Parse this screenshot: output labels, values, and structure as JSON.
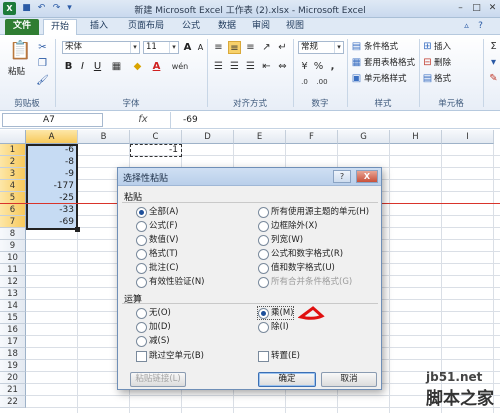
{
  "window": {
    "title": "新建 Microsoft Excel 工作表 (2).xlsx - Microsoft Excel",
    "app_icon": "X",
    "qat_icons": [
      "save-icon",
      "undo-icon",
      "redo-icon"
    ],
    "window_controls": [
      "minimize",
      "maximize",
      "close"
    ]
  },
  "tabs": [
    "文件",
    "开始",
    "插入",
    "页面布局",
    "公式",
    "数据",
    "审阅",
    "视图"
  ],
  "ribbon": {
    "clipboard": {
      "label": "剪贴板",
      "paste": "粘贴"
    },
    "font": {
      "label": "字体",
      "font_name": "宋体",
      "font_size": "11",
      "bold": "B",
      "italic": "I",
      "underline": "U",
      "grow": "A",
      "shrink": "A",
      "font_color": "A",
      "wen": "wén"
    },
    "alignment": {
      "label": "对齐方式"
    },
    "number": {
      "label": "数字",
      "format": "常规",
      "percent": "%",
      "comma": ",",
      "currency": "¥",
      "dec_inc": ".0",
      "dec_dec": ".00"
    },
    "styles": {
      "label": "样式",
      "cond": "条件格式",
      "table": "套用表格格式",
      "cell": "单元格样式"
    },
    "cells": {
      "label": "单元格",
      "insert": "插入",
      "delete": "删除",
      "format": "格式"
    }
  },
  "formula_bar": {
    "name_box": "A7",
    "fx": "fx",
    "value": "-69"
  },
  "grid": {
    "columns": [
      "A",
      "B",
      "C",
      "D",
      "E",
      "F",
      "G",
      "H",
      "I"
    ],
    "rows": [
      "1",
      "2",
      "3",
      "4",
      "5",
      "6",
      "7",
      "8",
      "9",
      "10",
      "11",
      "12",
      "13",
      "14",
      "15",
      "16",
      "17",
      "18",
      "19",
      "20",
      "21",
      "22"
    ],
    "column_a": [
      "-6",
      "-8",
      "-9",
      "-177",
      "-25",
      "-33",
      "-69"
    ],
    "c1": "-1"
  },
  "dialog": {
    "title": "选择性粘贴",
    "help": "?",
    "close": "X",
    "paste_section": "粘贴",
    "paste_left": [
      "全部(A)",
      "公式(F)",
      "数值(V)",
      "格式(T)",
      "批注(C)",
      "有效性验证(N)"
    ],
    "paste_right": [
      "所有使用源主题的单元(H)",
      "边框除外(X)",
      "列宽(W)",
      "公式和数字格式(R)",
      "值和数字格式(U)",
      "所有合并条件格式(G)"
    ],
    "op_section": "运算",
    "op_left": [
      "无(O)",
      "加(D)",
      "减(S)"
    ],
    "op_right": [
      "乘(M)",
      "除(I)"
    ],
    "skip_blanks": "跳过空单元(B)",
    "transpose": "转置(E)",
    "paste_link": "粘贴链接(L)",
    "ok": "确定",
    "cancel": "取消"
  },
  "watermark": {
    "line1": "jb51.net",
    "line2": "脚本之家"
  },
  "colors": {
    "file_tab": "#2f7d32",
    "selection": "#c6dbf3",
    "annotation_red": "#e01010",
    "red_line": "#d9342b"
  }
}
